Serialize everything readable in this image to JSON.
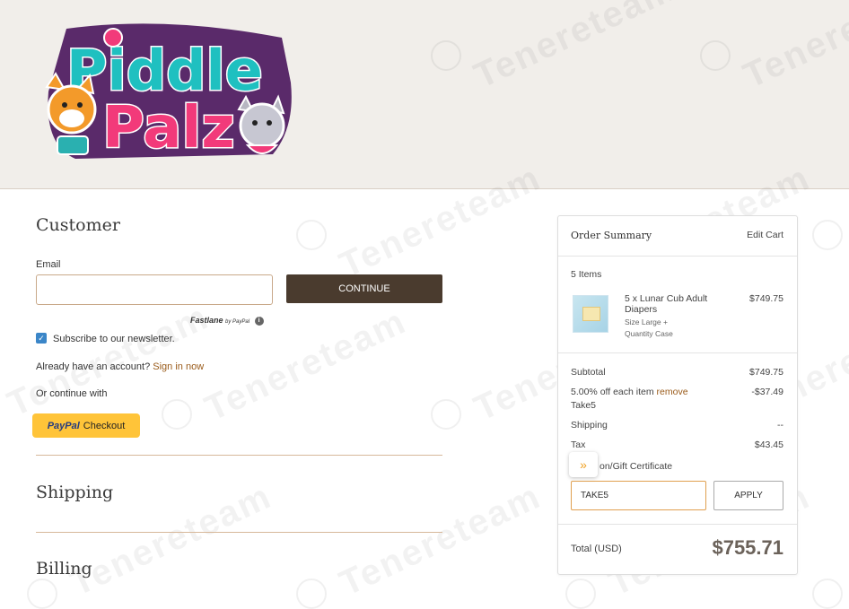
{
  "brand": {
    "name_line1": "Piddle",
    "name_line2": "Palz"
  },
  "watermark": {
    "text": "Tenereteam",
    "icon_caption": "tenere"
  },
  "customer": {
    "title": "Customer",
    "email_label": "Email",
    "email_value": "",
    "continue_label": "CONTINUE",
    "fastlane_brand": "Fastlane",
    "fastlane_by": "by PayPal",
    "newsletter_label": "Subscribe to our newsletter.",
    "newsletter_checked": true,
    "account_prompt": "Already have an account?",
    "sign_in_label": "Sign in now",
    "continue_with": "Or continue with",
    "paypal_word": "PayPal",
    "paypal_action": "Checkout"
  },
  "shipping": {
    "title": "Shipping"
  },
  "billing": {
    "title": "Billing"
  },
  "order_summary": {
    "title": "Order Summary",
    "edit_cart_label": "Edit Cart",
    "items_count": "5 Items",
    "item": {
      "name": "5 x Lunar Cub Adult Diapers",
      "size": "Size Large +",
      "quantity": "Quantity Case",
      "price": "$749.75"
    },
    "subtotal_label": "Subtotal",
    "subtotal_value": "$749.75",
    "discount_label": "5.00% off each item",
    "discount_remove": "remove",
    "discount_code": "Take5",
    "discount_value": "-$37.49",
    "shipping_label": "Shipping",
    "shipping_value": "--",
    "tax_label": "Tax",
    "tax_value": "$43.45",
    "coupon_label": "on/Gift Certificate",
    "coupon_value": "TAKE5",
    "apply_label": "APPLY",
    "total_label": "Total (USD)",
    "total_value": "$755.71"
  },
  "colors": {
    "accent": "#9a5b1a",
    "button_dark": "#4a3b2e",
    "paypal_yellow": "#ffc439",
    "header_bg": "#f1eeea"
  }
}
